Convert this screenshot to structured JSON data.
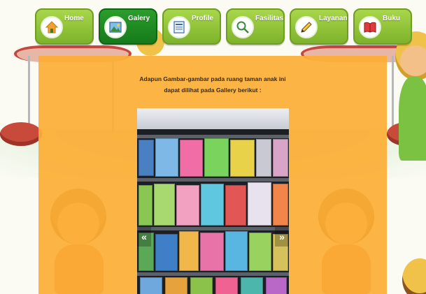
{
  "nav": {
    "items": [
      {
        "label": "Home",
        "icon": "house-icon",
        "active": false
      },
      {
        "label": "Galery",
        "icon": "picture-icon",
        "active": true
      },
      {
        "label": "Profile",
        "icon": "document-icon",
        "active": false
      },
      {
        "label": "Fasilitas",
        "icon": "magnifier-icon",
        "active": false
      },
      {
        "label": "Layanan",
        "icon": "pencil-icon",
        "active": false
      },
      {
        "label": "Buku",
        "icon": "book-icon",
        "active": false
      }
    ]
  },
  "main": {
    "intro_line1": "Adapun Gambar-gambar pada ruang taman anak ini",
    "intro_line2": "dapat dilihat pada Gallery berikut :"
  },
  "gallery": {
    "prev_label": "«",
    "next_label": "»"
  },
  "colors": {
    "panel": "#fcae34",
    "nav_green": "#8cc43a",
    "nav_active": "#1f8a22"
  }
}
